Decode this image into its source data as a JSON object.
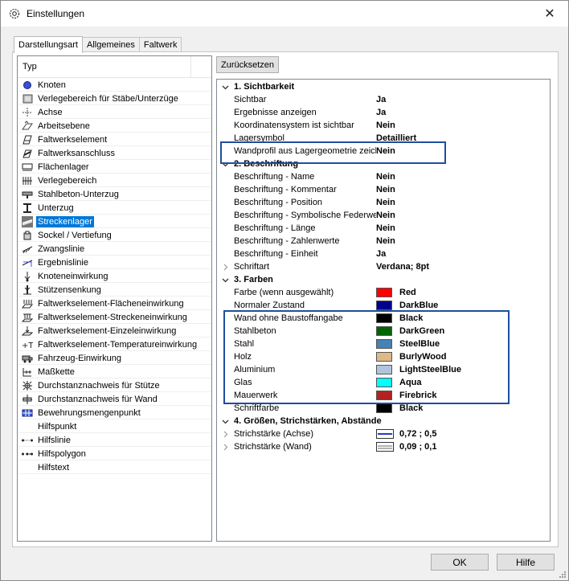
{
  "window": {
    "title": "Einstellungen",
    "icon": "gear-icon",
    "close_glyph": "✕"
  },
  "tabs": [
    {
      "label": "Darstellungsart",
      "active": true
    },
    {
      "label": "Allgemeines",
      "active": false
    },
    {
      "label": "Faltwerk",
      "active": false
    }
  ],
  "tree": {
    "header": "Typ",
    "items": [
      {
        "label": "Knoten",
        "icon": "node-icon"
      },
      {
        "label": "Verlegebereich für Stäbe/Unterzüge",
        "icon": "area-icon"
      },
      {
        "label": "Achse",
        "icon": "axis-icon"
      },
      {
        "label": "Arbeitsebene",
        "icon": "workplane-icon"
      },
      {
        "label": "Faltwerkselement",
        "icon": "element-icon"
      },
      {
        "label": "Faltwerksanschluss",
        "icon": "connection-icon"
      },
      {
        "label": "Flächenlager",
        "icon": "surface-support-icon"
      },
      {
        "label": "Verlegebereich",
        "icon": "placement-area-icon"
      },
      {
        "label": "Stahlbeton-Unterzug",
        "icon": "beam-icon"
      },
      {
        "label": "Unterzug",
        "icon": "girder-icon"
      },
      {
        "label": "Streckenlager",
        "icon": "line-support-icon",
        "selected": true
      },
      {
        "label": "Sockel / Vertiefung",
        "icon": "pedestal-icon"
      },
      {
        "label": "Zwangslinie",
        "icon": "constraint-line-icon"
      },
      {
        "label": "Ergebnislinie",
        "icon": "result-line-icon"
      },
      {
        "label": "Knoteneinwirkung",
        "icon": "node-load-icon"
      },
      {
        "label": "Stützensenkung",
        "icon": "column-settlement-icon"
      },
      {
        "label": "Faltwerkselement-Flächeneinwirkung",
        "icon": "surface-load-icon"
      },
      {
        "label": "Faltwerkselement-Streckeneinwirkung",
        "icon": "line-load-icon"
      },
      {
        "label": "Faltwerkselement-Einzeleinwirkung",
        "icon": "point-load-icon"
      },
      {
        "label": "Faltwerkselement-Temperatureinwirkung",
        "icon": "temperature-load-icon"
      },
      {
        "label": "Fahrzeug-Einwirkung",
        "icon": "vehicle-load-icon"
      },
      {
        "label": "Maßkette",
        "icon": "dimension-chain-icon"
      },
      {
        "label": "Durchstanznachweis für Stütze",
        "icon": "punching-column-icon"
      },
      {
        "label": "Durchstanznachweis für Wand",
        "icon": "punching-wall-icon"
      },
      {
        "label": "Bewehrungsmengenpunkt",
        "icon": "reinforcement-point-icon"
      },
      {
        "label": "Hilfspunkt",
        "icon": ""
      },
      {
        "label": "Hilfslinie",
        "icon": "helper-line-icon"
      },
      {
        "label": "Hilfspolygon",
        "icon": "helper-polygon-icon"
      },
      {
        "label": "Hilfstext",
        "icon": ""
      }
    ]
  },
  "reset_button": "Zurücksetzen",
  "properties": [
    {
      "type": "cat",
      "label": "1. Sichtbarkeit",
      "expander": "collapse"
    },
    {
      "type": "prop",
      "name": "Sichtbar",
      "value": "Ja"
    },
    {
      "type": "prop",
      "name": "Ergebnisse anzeigen",
      "value": "Ja"
    },
    {
      "type": "prop",
      "name": "Koordinatensystem ist sichtbar",
      "value": "Nein"
    },
    {
      "type": "prop",
      "name": "Lagersymbol",
      "value": "Detailliert"
    },
    {
      "type": "prop",
      "name": "Wandprofil aus Lagergeometrie zeichnen",
      "value": "Nein"
    },
    {
      "type": "cat",
      "label": "2. Beschriftung",
      "expander": "collapse"
    },
    {
      "type": "prop",
      "name": "Beschriftung - Name",
      "value": "Nein"
    },
    {
      "type": "prop",
      "name": "Beschriftung - Kommentar",
      "value": "Nein"
    },
    {
      "type": "prop",
      "name": "Beschriftung - Position",
      "value": "Nein"
    },
    {
      "type": "prop",
      "name": "Beschriftung - Symbolische Federwerte",
      "value": "Nein"
    },
    {
      "type": "prop",
      "name": "Beschriftung - Länge",
      "value": "Nein"
    },
    {
      "type": "prop",
      "name": "Beschriftung - Zahlenwerte",
      "value": "Nein"
    },
    {
      "type": "prop",
      "name": "Beschriftung - Einheit",
      "value": "Ja"
    },
    {
      "type": "prop",
      "name": "Schriftart",
      "value": "Verdana; 8pt",
      "expander": "expand"
    },
    {
      "type": "cat",
      "label": "3. Farben",
      "expander": "collapse"
    },
    {
      "type": "prop",
      "name": "Farbe (wenn ausgewählt)",
      "value": "Red",
      "color": "#ff0000"
    },
    {
      "type": "prop",
      "name": "Normaler Zustand",
      "value": "DarkBlue",
      "color": "#00008b"
    },
    {
      "type": "prop",
      "name": "Wand ohne Baustoffangabe",
      "value": "Black",
      "color": "#000000"
    },
    {
      "type": "prop",
      "name": "Stahlbeton",
      "value": "DarkGreen",
      "color": "#006400"
    },
    {
      "type": "prop",
      "name": "Stahl",
      "value": "SteelBlue",
      "color": "#4682b4"
    },
    {
      "type": "prop",
      "name": "Holz",
      "value": "BurlyWood",
      "color": "#deb887"
    },
    {
      "type": "prop",
      "name": "Aluminium",
      "value": "LightSteelBlue",
      "color": "#b0c4de"
    },
    {
      "type": "prop",
      "name": "Glas",
      "value": "Aqua",
      "color": "#00ffff"
    },
    {
      "type": "prop",
      "name": "Mauerwerk",
      "value": "Firebrick",
      "color": "#b22222"
    },
    {
      "type": "prop",
      "name": "Schriftfarbe",
      "value": "Black",
      "color": "#000000"
    },
    {
      "type": "cat",
      "label": "4. Größen, Strichstärken, Abstände",
      "expander": "collapse"
    },
    {
      "type": "prop",
      "name": "Strichstärke (Achse)",
      "value": "0,72 ; 0,5",
      "expander": "expand",
      "line": "axis"
    },
    {
      "type": "prop",
      "name": "Strichstärke (Wand)",
      "value": "0,09 ; 0,1",
      "expander": "expand",
      "line": "wall"
    }
  ],
  "footer": {
    "ok": "OK",
    "help": "Hilfe"
  },
  "colors": {
    "selection": "#0078d7",
    "callout": "#1f4e9e"
  }
}
